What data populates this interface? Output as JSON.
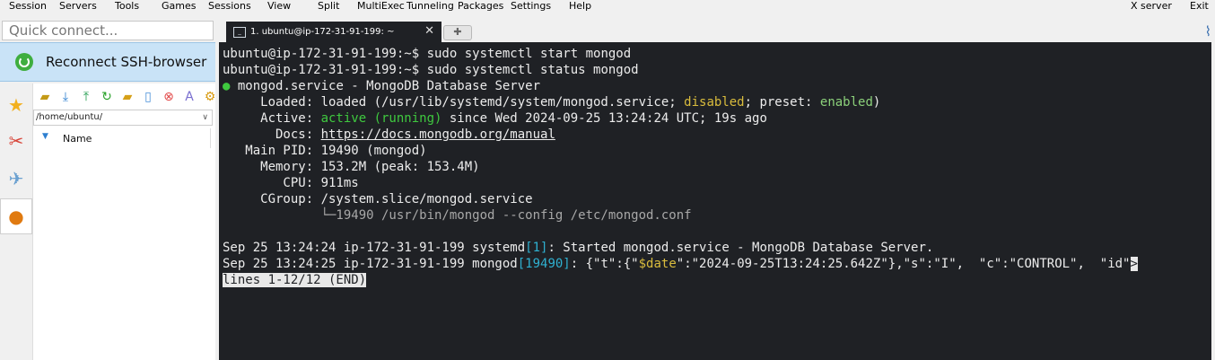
{
  "menu": {
    "session": "Session",
    "servers": "Servers",
    "tools": "Tools",
    "games": "Games",
    "sessions": "Sessions",
    "view": "View",
    "split": "Split",
    "multiexec": "MultiExec",
    "tunneling": "Tunneling",
    "packages": "Packages",
    "settings": "Settings",
    "help": "Help",
    "xserver": "X server",
    "exit": "Exit"
  },
  "quick_connect": {
    "placeholder": "Quick connect..."
  },
  "reconnect": {
    "label": "Reconnect SSH-browser"
  },
  "side_tabs": [
    {
      "icon": "star-icon"
    },
    {
      "icon": "tools-icon"
    },
    {
      "icon": "paper-plane-icon"
    },
    {
      "icon": "globe-icon",
      "active": true
    }
  ],
  "browser": {
    "toolbar_icons": [
      "parent-folder-icon",
      "download-icon",
      "upload-icon",
      "refresh-icon",
      "new-folder-icon",
      "new-file-icon",
      "delete-icon",
      "rename-icon",
      "settings-icon"
    ],
    "path": "/home/ubuntu/",
    "column_name": "Name"
  },
  "tabs": [
    {
      "label": "1. ubuntu@ip-172-31-91-199: ~"
    }
  ],
  "terminal": {
    "l1_prompt": "ubuntu@ip-172-31-91-199:~$ ",
    "l1_cmd": "sudo systemctl start mongod",
    "l2_prompt": "ubuntu@ip-172-31-91-199:~$ ",
    "l2_cmd": "sudo systemctl status mongod",
    "l3_dot": "●",
    "l3_text": " mongod.service - MongoDB Database Server",
    "l4_a": "     Loaded: loaded (/usr/lib/systemd/system/mongod.service; ",
    "l4_disabled": "disabled",
    "l4_b": "; preset: ",
    "l4_enabled": "enabled",
    "l4_c": ")",
    "l5_a": "     Active: ",
    "l5_active": "active (running)",
    "l5_b": " since Wed 2024-09-25 13:24:24 UTC; 19s ago",
    "l6_a": "       Docs: ",
    "l6_link": "https://docs.mongodb.org/manual",
    "l7": "   Main PID: 19490 (mongod)",
    "l8": "     Memory: 153.2M (peak: 153.4M)",
    "l9": "        CPU: 911ms",
    "l10": "     CGroup: /system.slice/mongod.service",
    "l11": "             └─19490 /usr/bin/mongod --config /etc/mongod.conf",
    "l13_a": "Sep 25 13:24:24 ip-172-31-91-199 systemd",
    "l13_pid": "[1]",
    "l13_b": ": Started mongod.service - MongoDB Database Server.",
    "l14_a": "Sep 25 13:24:25 ip-172-31-91-199 mongod",
    "l14_pid": "[19490]",
    "l14_b": ": {\"t\":{\"",
    "l14_date": "$date",
    "l14_c": "\":\"2024-09-25T13:24:25.642Z\"},\"s\":\"I\",  \"c\":\"CONTROL\",  \"id\"",
    "l14_more": ">",
    "l15": "lines 1-12/12 (END)"
  }
}
